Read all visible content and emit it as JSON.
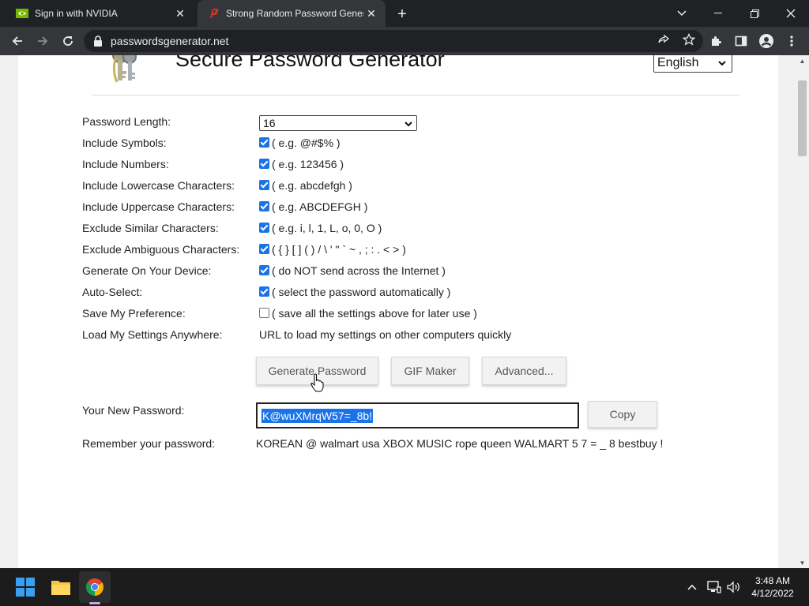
{
  "browser": {
    "tabs": [
      {
        "title": "Sign in with NVIDIA",
        "active": false
      },
      {
        "title": "Strong Random Password Generator",
        "active": true
      }
    ],
    "url": "passwordsgenerator.net"
  },
  "page": {
    "title": "Secure Password Generator",
    "language": "English",
    "password_length_label": "Password Length:",
    "password_length_value": "16",
    "options": [
      {
        "label": "Include Symbols:",
        "desc": "( e.g. @#$% )",
        "checked": true
      },
      {
        "label": "Include Numbers:",
        "desc": "( e.g. 123456 )",
        "checked": true
      },
      {
        "label": "Include Lowercase Characters:",
        "desc": "( e.g. abcdefgh )",
        "checked": true
      },
      {
        "label": "Include Uppercase Characters:",
        "desc": "( e.g. ABCDEFGH )",
        "checked": true
      },
      {
        "label": "Exclude Similar Characters:",
        "desc": "( e.g. i, l, 1, L, o, 0, O )",
        "checked": true
      },
      {
        "label": "Exclude Ambiguous Characters:",
        "desc": "( { } [ ] ( ) / \\ ' \" ` ~ , ; : . < > )",
        "checked": true
      },
      {
        "label": "Generate On Your Device:",
        "desc": "( do NOT send across the Internet )",
        "checked": true
      },
      {
        "label": "Auto-Select:",
        "desc": "( select the password automatically )",
        "checked": true
      },
      {
        "label": "Save My Preference:",
        "desc": "( save all the settings above for later use )",
        "checked": false
      }
    ],
    "load_settings_label": "Load My Settings Anywhere:",
    "load_settings_desc": "URL to load my settings on other computers quickly",
    "buttons": {
      "generate": "Generate Password",
      "gif": "GIF Maker",
      "advanced": "Advanced...",
      "copy": "Copy"
    },
    "new_password_label": "Your New Password:",
    "new_password_value": "K@wuXMrqW57=_8b!",
    "remember_label": "Remember your password:",
    "remember_value": "KOREAN @ walmart usa XBOX MUSIC rope queen WALMART 5 7 = _ 8 bestbuy !"
  },
  "taskbar": {
    "time": "3:48 AM",
    "date": "4/12/2022"
  }
}
